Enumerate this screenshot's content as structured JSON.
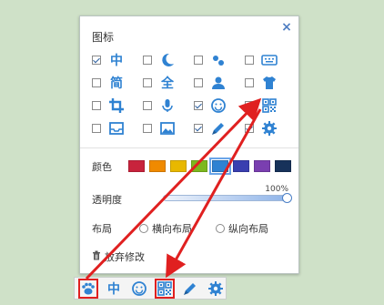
{
  "panel": {
    "section_title": "图标",
    "close_label": "×",
    "icons": [
      {
        "name": "chinese-mode-icon",
        "glyph": "中",
        "checked": true
      },
      {
        "name": "moon-icon",
        "glyph": "",
        "checked": false
      },
      {
        "name": "punctuation-icon",
        "glyph": "",
        "checked": false
      },
      {
        "name": "keyboard-icon",
        "glyph": "",
        "checked": false
      },
      {
        "name": "simplified-icon",
        "glyph": "简",
        "checked": false
      },
      {
        "name": "fullwidth-icon",
        "glyph": "全",
        "checked": false
      },
      {
        "name": "user-icon",
        "glyph": "",
        "checked": false
      },
      {
        "name": "skin-icon",
        "glyph": "",
        "checked": false
      },
      {
        "name": "crop-icon",
        "glyph": "",
        "checked": false
      },
      {
        "name": "microphone-icon",
        "glyph": "",
        "checked": false
      },
      {
        "name": "emoji-icon",
        "glyph": "",
        "checked": true
      },
      {
        "name": "qrcode-icon",
        "glyph": "",
        "checked": true
      },
      {
        "name": "inbox-icon",
        "glyph": "",
        "checked": false
      },
      {
        "name": "image-icon",
        "glyph": "",
        "checked": false
      },
      {
        "name": "pen-icon",
        "glyph": "",
        "checked": true
      },
      {
        "name": "settings-icon",
        "glyph": "",
        "checked": true
      }
    ],
    "color_label": "颜色",
    "colors": [
      "#c8233c",
      "#f08a00",
      "#e8b800",
      "#7cb81e",
      "#2f82d2",
      "#3a3fb0",
      "#7a3fb0",
      "#17325a"
    ],
    "selected_color_index": 4,
    "opacity_label": "透明度",
    "opacity_value": "100%",
    "opacity_fraction": 1.0,
    "layout_label": "布局",
    "layout_horizontal": "横向布局",
    "layout_vertical": "纵向布局",
    "abandon_label": "放弃修改"
  },
  "toolbar": {
    "items": [
      {
        "name": "paw-icon",
        "glyph": "",
        "highlight": true
      },
      {
        "name": "chinese-mode-icon",
        "glyph": "中",
        "highlight": false
      },
      {
        "name": "emoji-icon",
        "glyph": "",
        "highlight": false
      },
      {
        "name": "qrcode-icon",
        "glyph": "",
        "highlight": true
      },
      {
        "name": "pen-icon",
        "glyph": "",
        "highlight": false
      },
      {
        "name": "settings-icon",
        "glyph": "",
        "highlight": false
      }
    ]
  }
}
